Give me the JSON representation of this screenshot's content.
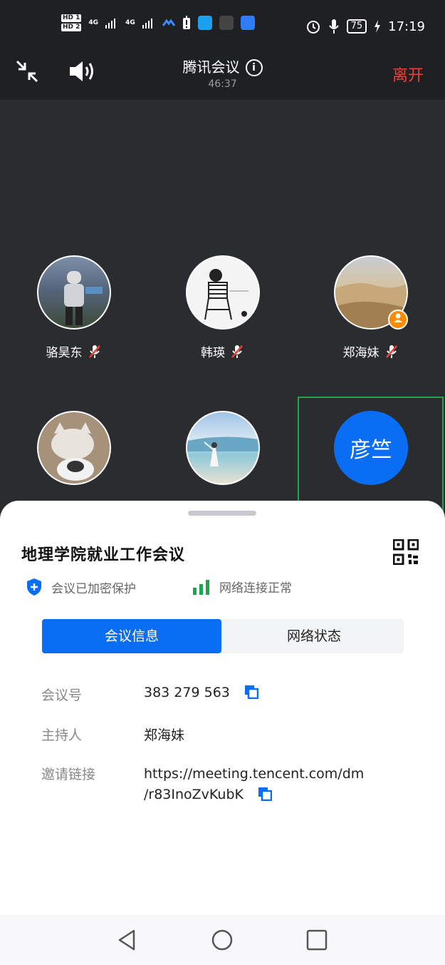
{
  "status_bar": {
    "hd1": "HD 1",
    "hd2": "HD 2",
    "signal1": "4G",
    "signal2": "4G",
    "battery": "75",
    "time": "17:19"
  },
  "top_bar": {
    "title": "腾讯会议",
    "timer": "46:37",
    "leave_label": "离开"
  },
  "participants": [
    {
      "name": "骆昊东"
    },
    {
      "name": "韩瑛"
    },
    {
      "name": "郑海妹"
    },
    {
      "name": ""
    },
    {
      "name": ""
    },
    {
      "name": "",
      "avatar_text": "彦竺"
    }
  ],
  "sheet": {
    "meeting_title": "地理学院就业工作会议",
    "encrypted_label": "会议已加密保护",
    "network_label": "网络连接正常",
    "tab_info": "会议信息",
    "tab_network": "网络状态",
    "meeting_id_label": "会议号",
    "meeting_id": "383 279 563",
    "host_label": "主持人",
    "host": "郑海妹",
    "link_label": "邀请链接",
    "link_line1": "https://meeting.tencent.com/dm",
    "link_line2": "/r83InoZvKubK"
  },
  "colors": {
    "accent": "#0a6ef5",
    "leave": "#e8433b",
    "active_border": "#1aa74b"
  }
}
